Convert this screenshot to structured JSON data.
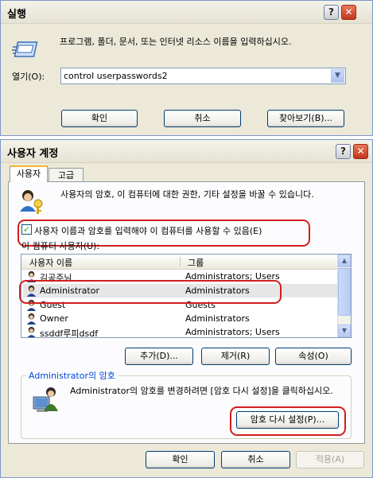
{
  "run_dialog": {
    "title": "실행",
    "description": "프로그램, 폴더, 문서, 또는 인터넷 리소스 이름을 입력하십시오.",
    "open_label": "열기(O):",
    "open_value": "control userpasswords2",
    "ok": "확인",
    "cancel": "취소",
    "browse": "찾아보기(B)..."
  },
  "accounts_dialog": {
    "title": "사용자 계정",
    "tabs": [
      "사용자",
      "고급"
    ],
    "intro": "사용자의 암호, 이 컴퓨터에 대한 권한, 기타 설정을 바꿀 수 있습니다.",
    "checkbox_label": "사용자 이름과 암호를 입력해야 이 컴퓨터를 사용할 수 있음(E)",
    "checkbox_checked": true,
    "users_label": "이 컴퓨터 사용자(U):",
    "columns": [
      "사용자 이름",
      "그룹"
    ],
    "rows": [
      {
        "name": "김공주님",
        "group": "Administrators; Users"
      },
      {
        "name": "Administrator",
        "group": "Administrators"
      },
      {
        "name": "Guest",
        "group": "Guests"
      },
      {
        "name": "Owner",
        "group": "Administrators"
      },
      {
        "name": "ssddf루피dsdf",
        "group": "Administrators; Users"
      }
    ],
    "selected_row": 1,
    "add": "추가(D)...",
    "remove": "제거(R)",
    "properties": "속성(O)",
    "group_title": "Administrator의 암호",
    "group_text": "Administrator의 암호를 변경하려면 [암호 다시 설정]을 클릭하십시오.",
    "reset_password": "암호 다시 설정(P)...",
    "ok": "확인",
    "cancel": "취소",
    "apply": "적용(A)"
  },
  "colors": {
    "highlight": "#d11e1e",
    "dialog_bg": "#ece9d8",
    "link_blue": "#0046d5"
  },
  "icons": [
    "run-icon",
    "users-icon",
    "user-icon",
    "admin-computer-icon",
    "help-icon",
    "close-icon"
  ]
}
